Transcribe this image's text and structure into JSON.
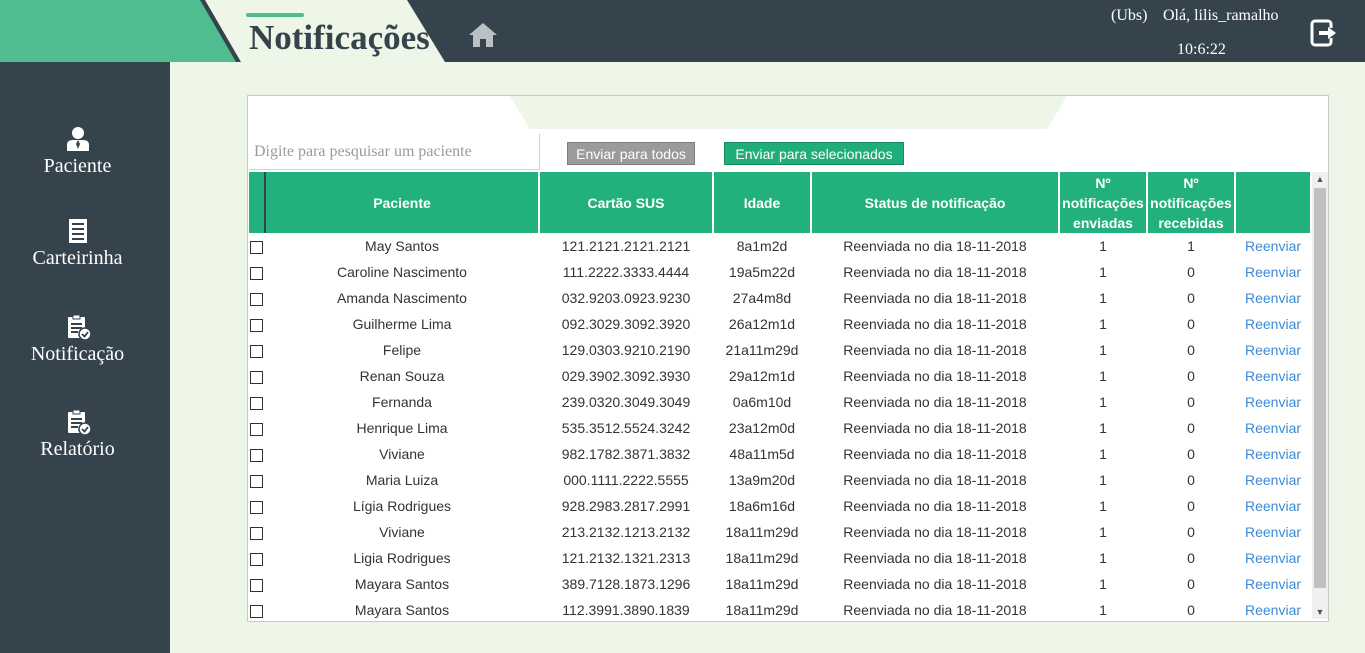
{
  "header": {
    "title": "Notificações",
    "ubs": "(Ubs)",
    "greeting": "Olá, lilis_ramalho",
    "clock": "10:6:22",
    "home_icon": "home-icon",
    "logout_icon": "logout-icon"
  },
  "sidebar": {
    "items": [
      {
        "label": "Paciente",
        "icon": "user-icon"
      },
      {
        "label": "Carteirinha",
        "icon": "card-list-icon"
      },
      {
        "label": "Notificação",
        "icon": "clipboard-check-icon"
      },
      {
        "label": "Relatório",
        "icon": "clipboard-check-icon"
      }
    ]
  },
  "search": {
    "placeholder": "Digite para pesquisar um paciente"
  },
  "buttons": {
    "send_all": "Enviar para todos",
    "send_selected": "Enviar para selecionados"
  },
  "table": {
    "columns": [
      "",
      "Paciente",
      "Cartão SUS",
      "Idade",
      "Status de notificação",
      "Nº notificações enviadas",
      "Nº notificações recebidas",
      ""
    ],
    "action_label": "Reenviar",
    "rows": [
      {
        "paciente": "May Santos",
        "cartao": "121.2121.2121.2121",
        "idade": "8a1m2d",
        "status": "Reenviada no dia 18-11-2018",
        "enviadas": "1",
        "recebidas": "1"
      },
      {
        "paciente": "Caroline Nascimento",
        "cartao": "111.2222.3333.4444",
        "idade": "19a5m22d",
        "status": "Reenviada no dia 18-11-2018",
        "enviadas": "1",
        "recebidas": "0"
      },
      {
        "paciente": "Amanda Nascimento",
        "cartao": "032.9203.0923.9230",
        "idade": "27a4m8d",
        "status": "Reenviada no dia 18-11-2018",
        "enviadas": "1",
        "recebidas": "0"
      },
      {
        "paciente": "Guilherme Lima",
        "cartao": "092.3029.3092.3920",
        "idade": "26a12m1d",
        "status": "Reenviada no dia 18-11-2018",
        "enviadas": "1",
        "recebidas": "0"
      },
      {
        "paciente": "Felipe",
        "cartao": "129.0303.9210.2190",
        "idade": "21a11m29d",
        "status": "Reenviada no dia 18-11-2018",
        "enviadas": "1",
        "recebidas": "0"
      },
      {
        "paciente": "Renan Souza",
        "cartao": "029.3902.3092.3930",
        "idade": "29a12m1d",
        "status": "Reenviada no dia 18-11-2018",
        "enviadas": "1",
        "recebidas": "0"
      },
      {
        "paciente": "Fernanda",
        "cartao": "239.0320.3049.3049",
        "idade": "0a6m10d",
        "status": "Reenviada no dia 18-11-2018",
        "enviadas": "1",
        "recebidas": "0"
      },
      {
        "paciente": "Henrique Lima",
        "cartao": "535.3512.5524.3242",
        "idade": "23a12m0d",
        "status": "Reenviada no dia 18-11-2018",
        "enviadas": "1",
        "recebidas": "0"
      },
      {
        "paciente": "Viviane",
        "cartao": "982.1782.3871.3832",
        "idade": "48a11m5d",
        "status": "Reenviada no dia 18-11-2018",
        "enviadas": "1",
        "recebidas": "0"
      },
      {
        "paciente": "Maria Luiza",
        "cartao": "000.1111.2222.5555",
        "idade": "13a9m20d",
        "status": "Reenviada no dia 18-11-2018",
        "enviadas": "1",
        "recebidas": "0"
      },
      {
        "paciente": "Lígia Rodrigues",
        "cartao": "928.2983.2817.2991",
        "idade": "18a6m16d",
        "status": "Reenviada no dia 18-11-2018",
        "enviadas": "1",
        "recebidas": "0"
      },
      {
        "paciente": "Viviane",
        "cartao": "213.2132.1213.2132",
        "idade": "18a11m29d",
        "status": "Reenviada no dia 18-11-2018",
        "enviadas": "1",
        "recebidas": "0"
      },
      {
        "paciente": "Ligia Rodrigues",
        "cartao": "121.2132.1321.2313",
        "idade": "18a11m29d",
        "status": "Reenviada no dia 18-11-2018",
        "enviadas": "1",
        "recebidas": "0"
      },
      {
        "paciente": "Mayara Santos",
        "cartao": "389.7128.1873.1296",
        "idade": "18a11m29d",
        "status": "Reenviada no dia 18-11-2018",
        "enviadas": "1",
        "recebidas": "0"
      },
      {
        "paciente": "Mayara Santos",
        "cartao": "112.3991.3890.1839",
        "idade": "18a11m29d",
        "status": "Reenviada no dia 18-11-2018",
        "enviadas": "1",
        "recebidas": "0"
      }
    ]
  },
  "colors": {
    "dark": "#35444c",
    "accent_green": "#4fbd90",
    "table_header": "#22b07c",
    "background": "#eef6e8",
    "link": "#3a8ad6"
  }
}
